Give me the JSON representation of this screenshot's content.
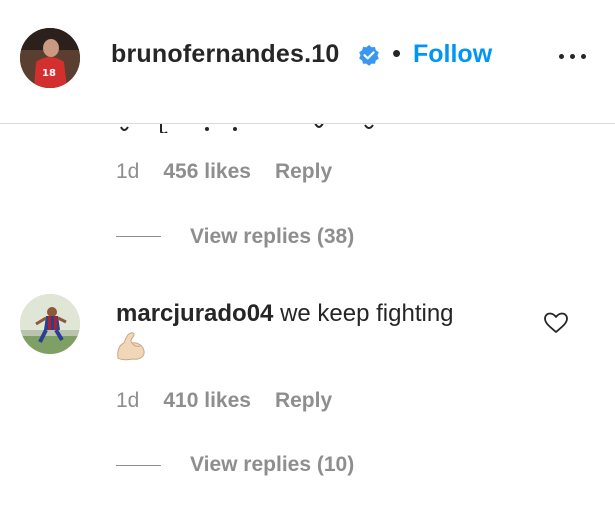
{
  "post_header": {
    "username": "brunofernandes.10",
    "separator": "•",
    "follow_label": "Follow",
    "verified_icon": "verified-badge-icon",
    "more_icon": "more-options-icon"
  },
  "comments": [
    {
      "time": "1d",
      "likes": "456 likes",
      "reply_label": "Reply",
      "view_replies": "View replies (38)"
    },
    {
      "username": "marcjurado04",
      "text": "we keep fighting",
      "emoji_icon": "flexed-biceps-icon",
      "time": "1d",
      "likes": "410 likes",
      "reply_label": "Reply",
      "view_replies": "View replies (10)"
    }
  ],
  "colors": {
    "link_blue": "#0095f6",
    "verified_blue": "#3897f0",
    "secondary_text": "#8e8e8e",
    "primary_text": "#262626"
  }
}
